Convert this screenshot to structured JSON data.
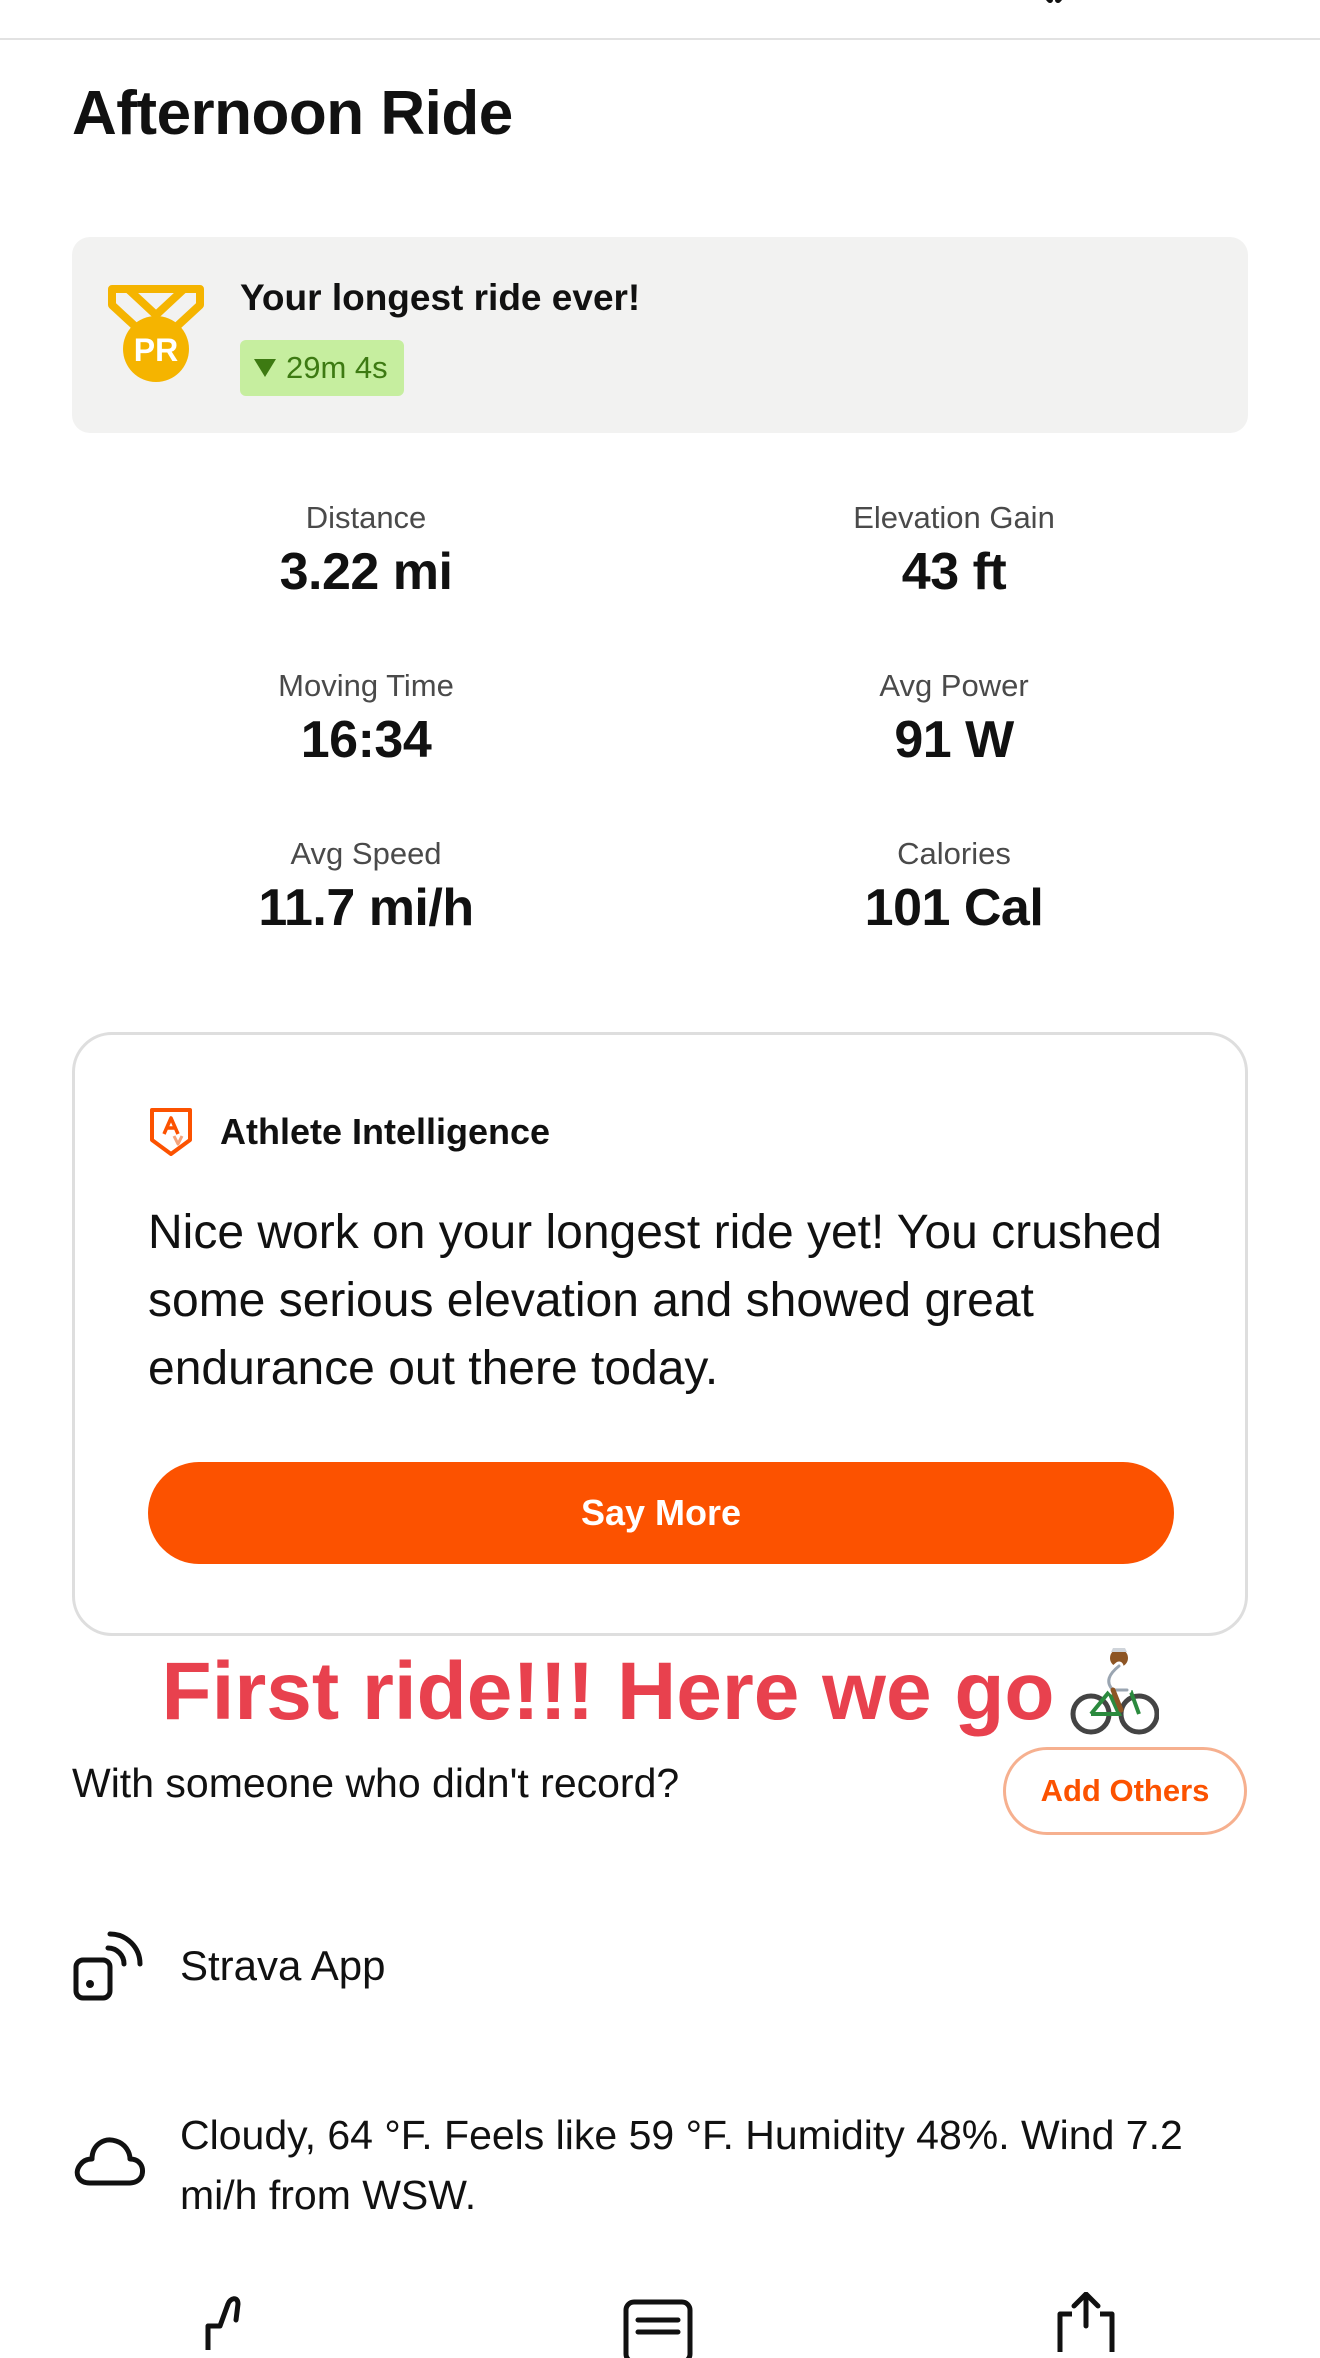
{
  "header": {
    "close_icon": "close-icon"
  },
  "activity": {
    "title": "Afternoon Ride"
  },
  "achievement": {
    "icon": "pr-medal-icon",
    "icon_text": "PR",
    "title": "Your longest ride ever!",
    "badge_icon": "down-triangle-icon",
    "badge_text": "29m 4s",
    "colors": {
      "medal": "#f5b400",
      "badge_bg": "#c6ee9f",
      "badge_text": "#3d7a12"
    }
  },
  "stats": [
    {
      "label": "Distance",
      "value": "3.22 mi"
    },
    {
      "label": "Elevation Gain",
      "value": "43 ft"
    },
    {
      "label": "Moving Time",
      "value": "16:34"
    },
    {
      "label": "Avg Power",
      "value": "91 W"
    },
    {
      "label": "Avg Speed",
      "value": "11.7 mi/h"
    },
    {
      "label": "Calories",
      "value": "101 Cal"
    }
  ],
  "athlete_intelligence": {
    "icon": "strava-ai-icon",
    "heading": "Athlete Intelligence",
    "body": "Nice work on your longest ride yet! You crushed some serious elevation and showed great endurance out there today.",
    "button_label": "Say More",
    "accent_color": "#fc5200"
  },
  "description": {
    "text": "First ride!!! Here we go",
    "emoji_icon": "cyclist-icon",
    "color": "#e8414e"
  },
  "group": {
    "prompt": "With someone who didn't record?",
    "button_label": "Add Others"
  },
  "device": {
    "icon": "phone-signal-icon",
    "name": "Strava App"
  },
  "weather": {
    "icon": "cloud-icon",
    "text": "Cloudy, 64 °F. Feels like 59 °F. Humidity 48%. Wind 7.2 mi/h from WSW."
  },
  "actions": [
    {
      "icon": "like-icon"
    },
    {
      "icon": "comment-icon"
    },
    {
      "icon": "share-icon"
    }
  ]
}
